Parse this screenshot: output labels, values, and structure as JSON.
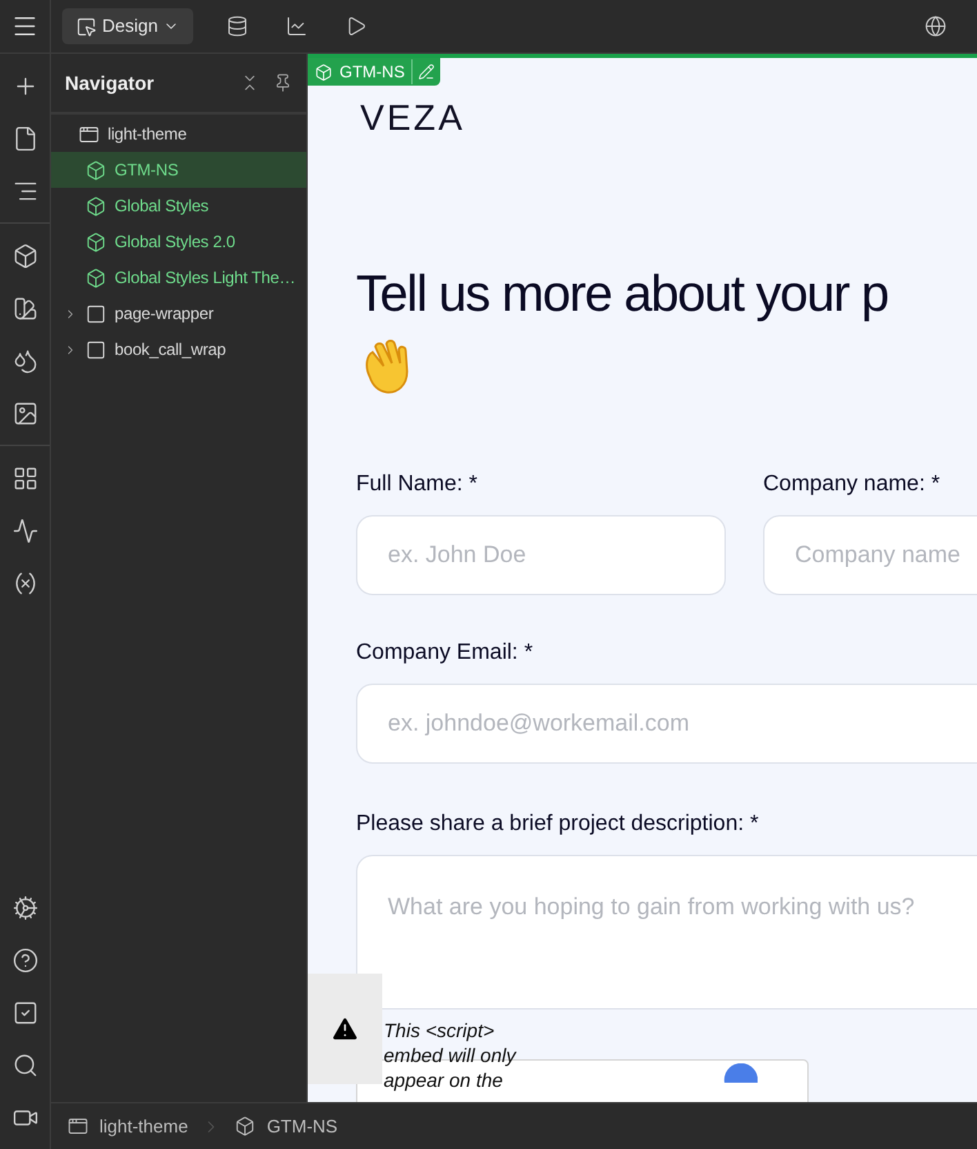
{
  "topbar": {
    "mode_button": "Design"
  },
  "navigator": {
    "title": "Navigator",
    "items": [
      {
        "label": "light-theme",
        "kind": "body",
        "selected": false,
        "children": [
          {
            "label": "GTM-NS",
            "kind": "component",
            "selected": true
          },
          {
            "label": "Global Styles",
            "kind": "component",
            "selected": false
          },
          {
            "label": "Global Styles 2.0",
            "kind": "component",
            "selected": false
          },
          {
            "label": "Global Styles Light The…",
            "kind": "component",
            "selected": false
          },
          {
            "label": "page-wrapper",
            "kind": "element",
            "selected": false,
            "expanded": false
          },
          {
            "label": "book_call_wrap",
            "kind": "element",
            "selected": false,
            "expanded": false
          }
        ]
      }
    ]
  },
  "canvas": {
    "selection_badge": "GTM-NS",
    "logo": "VEZA",
    "heading": "Tell us more about your p",
    "fields": [
      {
        "label": "Full Name: *",
        "placeholder": "ex. John Doe",
        "kind": "input"
      },
      {
        "label": "Company name: *",
        "placeholder": "Company name",
        "kind": "input"
      },
      {
        "label": "Company Email: *",
        "placeholder": "ex. johndoe@workemail.com",
        "kind": "input"
      },
      {
        "label": "Please share a brief project description: *",
        "placeholder": "What are you hoping to gain from working with us?",
        "kind": "textarea"
      }
    ],
    "script_notice": "This <script> embed will only appear on the"
  },
  "breadcrumbs": [
    {
      "label": "light-theme",
      "kind": "body"
    },
    {
      "label": "GTM-NS",
      "kind": "component"
    }
  ]
}
